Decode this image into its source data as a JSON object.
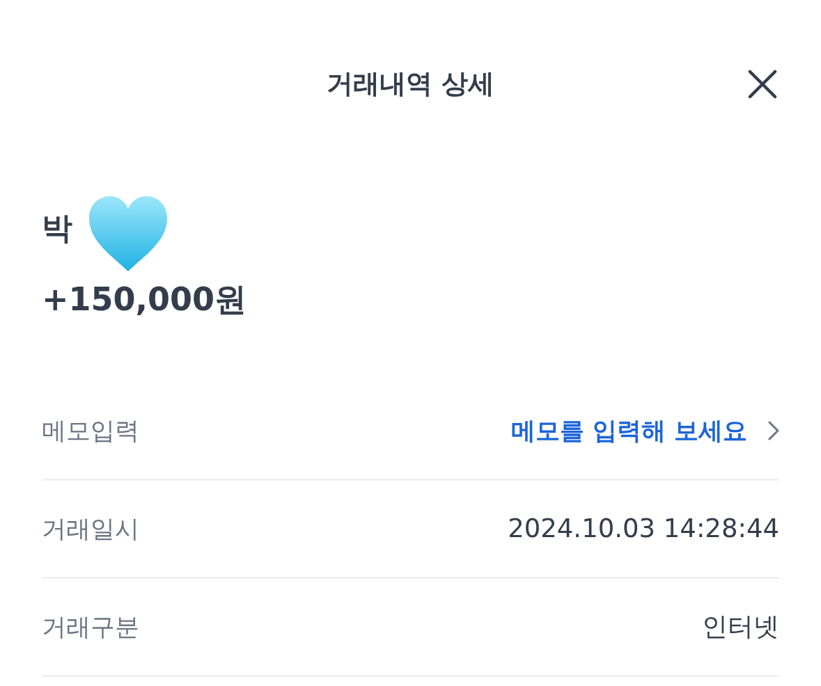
{
  "header": {
    "title": "거래내역 상세"
  },
  "summary": {
    "name": "박",
    "amount": "+150,000원"
  },
  "rows": [
    {
      "kind": "link",
      "label": "메모입력",
      "value": "메모를 입력해 보세요"
    },
    {
      "kind": "text",
      "label": "거래일시",
      "value": "2024.10.03 14:28:44"
    },
    {
      "kind": "text",
      "label": "거래구분",
      "value": "인터넷"
    }
  ]
}
